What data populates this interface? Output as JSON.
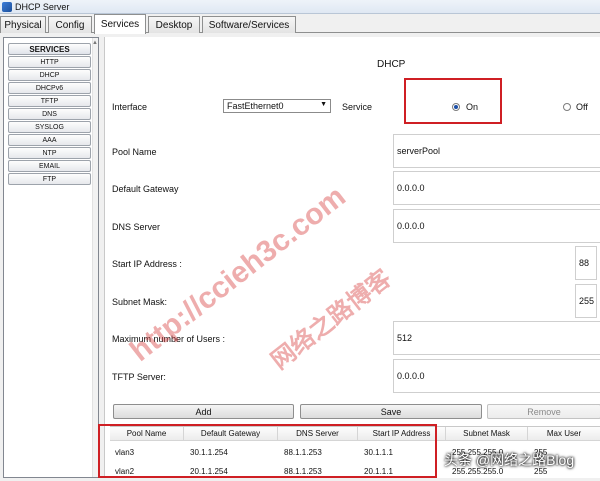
{
  "window": {
    "title": "DHCP Server"
  },
  "tabs": [
    {
      "label": "Physical"
    },
    {
      "label": "Config"
    },
    {
      "label": "Services"
    },
    {
      "label": "Desktop"
    },
    {
      "label": "Software/Services"
    }
  ],
  "sidebar": {
    "header": "SERVICES",
    "items": [
      "HTTP",
      "DHCP",
      "DHCPv6",
      "TFTP",
      "DNS",
      "SYSLOG",
      "AAA",
      "NTP",
      "EMAIL",
      "FTP"
    ]
  },
  "panel": {
    "title": "DHCP",
    "interface_label": "Interface",
    "interface_value": "FastEthernet0",
    "service_label": "Service",
    "on_label": "On",
    "off_label": "Off",
    "service_state": "On"
  },
  "form": {
    "pool_name_label": "Pool Name",
    "pool_name_value": "serverPool",
    "gateway_label": "Default Gateway",
    "gateway_value": "0.0.0.0",
    "dns_label": "DNS Server",
    "dns_value": "0.0.0.0",
    "start_ip_label": "Start IP Address :",
    "start_ip_value": "88",
    "mask_label": "Subnet Mask:",
    "mask_value": "255",
    "max_users_label": "Maximum number of Users :",
    "max_users_value": "512",
    "tftp_label": "TFTP Server:",
    "tftp_value": "0.0.0.0"
  },
  "buttons": {
    "add": "Add",
    "save": "Save",
    "remove": "Remove"
  },
  "table": {
    "columns": [
      "Pool Name",
      "Default Gateway",
      "DNS Server",
      "Start IP Address",
      "Subnet Mask",
      "Max User"
    ],
    "rows": [
      [
        "vlan3",
        "30.1.1.254",
        "88.1.1.253",
        "30.1.1.1",
        "255.255.255.0",
        "255"
      ],
      [
        "vlan2",
        "20.1.1.254",
        "88.1.1.253",
        "20.1.1.1",
        "255.255.255.0",
        "255"
      ]
    ]
  },
  "watermark": {
    "url_text": "http://ccieh3c.com",
    "blog_text": "网络之路博客",
    "credit_text": "头条 @网络之路Blog"
  },
  "colors": {
    "highlight": "#cf1f24",
    "watermark": "#d63c3c"
  }
}
